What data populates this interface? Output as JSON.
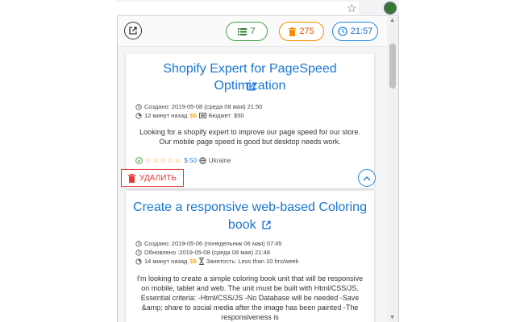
{
  "toolbar": {
    "count": "7",
    "trash_count": "275",
    "time": "21:57"
  },
  "cards": [
    {
      "title": "Shopify Expert for PageSpeed Optimization",
      "created": "Создано: 2019-05-08 (среда 08 мая) 21:50",
      "age": "12 минут назад",
      "money": "$$",
      "budget": "Бюджет: $50",
      "description": "Looking for a shopify expert to improve our page speed for our store. Our mobile page speed is good but desktop needs work.",
      "stars": "☆☆☆☆☆",
      "payment": "$ 50",
      "country": "Ukraine",
      "delete_label": "УДАЛИТЬ"
    },
    {
      "title_line1": "Create a responsive web-based Coloring",
      "title_line2": "book",
      "created": "Создано: 2019-05-06 (понедельник 06 мая) 07:45",
      "updated": "Обновлено :2019-05-08 (среда 08 мая) 21:48",
      "age": "14 минут назад",
      "money": "$$",
      "workload": "Занятость: Less than 10 hrs/week",
      "description": "I'm looking to create a simple coloring book unit that will be responsive on mobile, tablet and web. The unit must be built with Html/CSS/JS. Essential criteria: -Html/CSS/JS -No Database will be needed -Save &amp; share to social media after the image has been painted -The responsiveness is"
    }
  ],
  "colors": {
    "link": "#1976d2",
    "green": "#43a047",
    "orange": "#fb8c00",
    "blue": "#1e88e5",
    "red": "#e53935"
  }
}
